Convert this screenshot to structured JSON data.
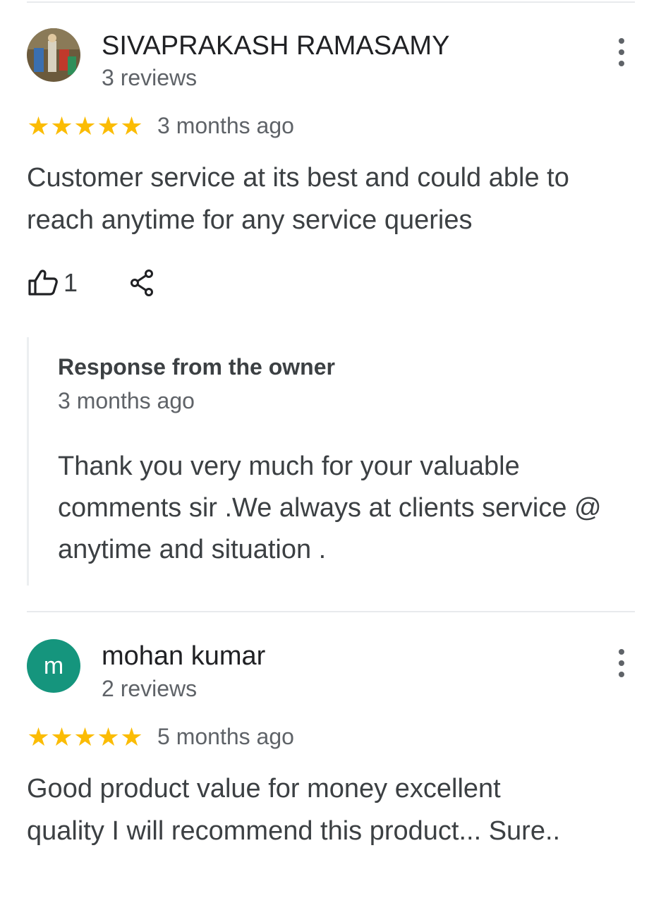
{
  "reviews": [
    {
      "author": "SIVAPRAKASH RAMASAMY",
      "review_count": "3 reviews",
      "stars": [
        "★",
        "★",
        "★",
        "★",
        "★"
      ],
      "rating": 5,
      "time": "3 months ago",
      "text": "Customer service at its best and could able to reach anytime for any service queries",
      "likes": "1",
      "owner_response": {
        "title": "Response from the owner",
        "time": "3 months ago",
        "text": "Thank you very much for your valuable comments sir .We always at clients service @ anytime and situation ."
      }
    },
    {
      "author": "mohan kumar",
      "avatar_letter": "m",
      "review_count": "2 reviews",
      "stars": [
        "★",
        "★",
        "★",
        "★",
        "★"
      ],
      "rating": 5,
      "time": "5 months ago",
      "text": "Good product value for money excellent quality I will recommend this product... Sure.."
    }
  ],
  "colors": {
    "star": "#fbbc04",
    "avatar_bg": "#15957d",
    "secondary_text": "#5f6368"
  },
  "icons": [
    "thumbs-up-icon",
    "share-icon",
    "more-vert-icon"
  ]
}
